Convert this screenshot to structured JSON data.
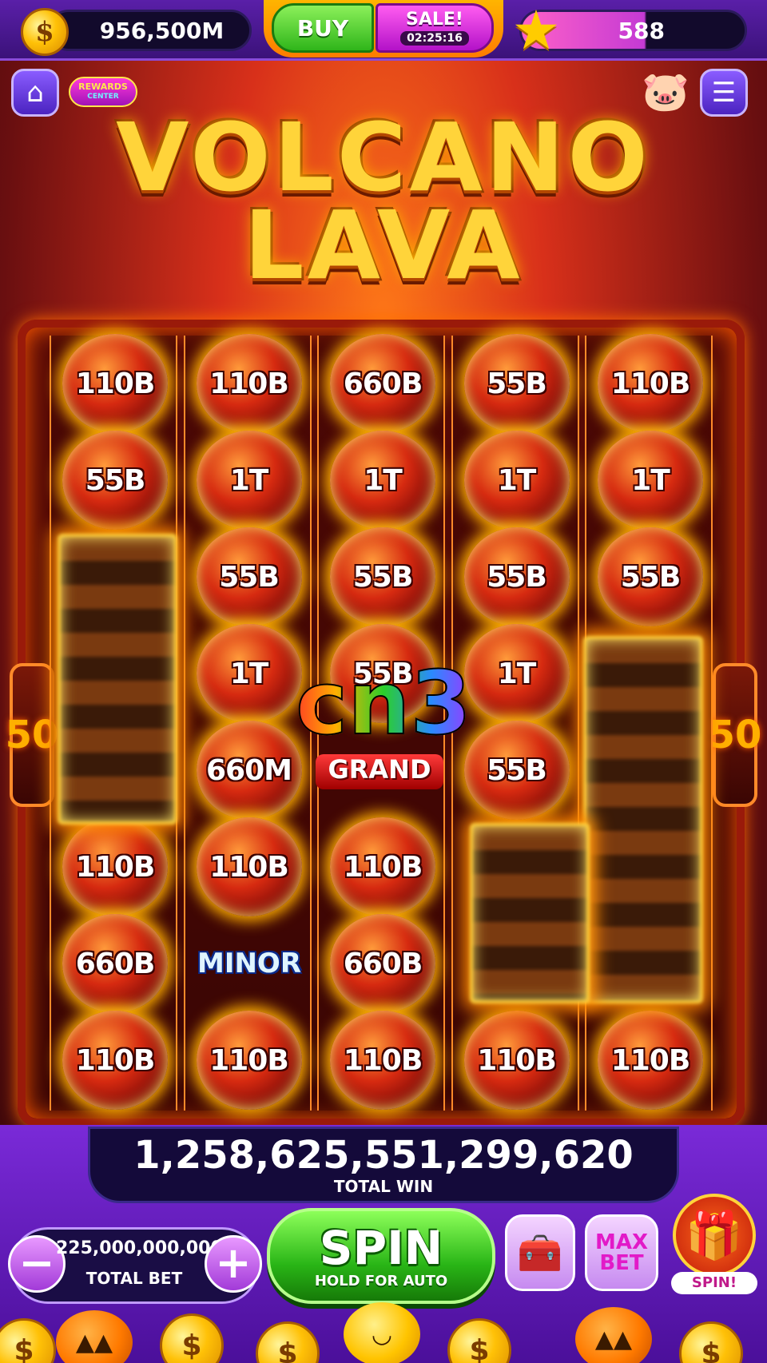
{
  "header": {
    "coins": "956,500M",
    "coin_icon": "coin-icon",
    "buy_label": "BUY",
    "sale_label": "SALE!",
    "sale_timer": "02:25:16",
    "level_value": "588",
    "star_icon": "star-icon"
  },
  "nav": {
    "home_icon": "home-icon",
    "rewards_line1": "REWARDS",
    "rewards_line2": "CENTER",
    "piggy_icon": "piggy-bank-icon",
    "menu_icon": "menu-icon"
  },
  "title": {
    "line1": "VOLCANO",
    "line2": "LAVA"
  },
  "reels": {
    "columns": [
      [
        "110B",
        "55B",
        "",
        "",
        "",
        "110B",
        "660B",
        "110B"
      ],
      [
        "110B",
        "1T",
        "55B",
        "1T",
        "660M",
        "110B",
        "",
        "110B"
      ],
      [
        "660B",
        "1T",
        "55B",
        "55B",
        "",
        "110B",
        "660B",
        "110B"
      ],
      [
        "55B",
        "1T",
        "55B",
        "1T",
        "55B",
        "",
        "",
        "110B"
      ],
      [
        "110B",
        "1T",
        "55B",
        "",
        "",
        "",
        "",
        "110B"
      ]
    ],
    "grand_label": "GRAND",
    "minor_label": "MINOR",
    "side_left": "50",
    "side_right": "50"
  },
  "watermark": "cn3",
  "win": {
    "total_win_value": "1,258,625,551,299,620",
    "total_win_label": "TOTAL WIN"
  },
  "bet": {
    "minus": "−",
    "plus": "+",
    "value": "225,000,000,000",
    "label": "TOTAL BET"
  },
  "spin": {
    "label": "SPIN",
    "sub": "HOLD FOR AUTO"
  },
  "controls": {
    "chest_icon": "treasure-chest-icon",
    "maxbet_line1": "MAX",
    "maxbet_line2": "BET",
    "gift_icon": "gift-icon",
    "gift_label": "SPIN!"
  },
  "colors": {
    "accent": "#7a2ad8",
    "spin_green": "#29b516",
    "lava": "#d62a10"
  }
}
